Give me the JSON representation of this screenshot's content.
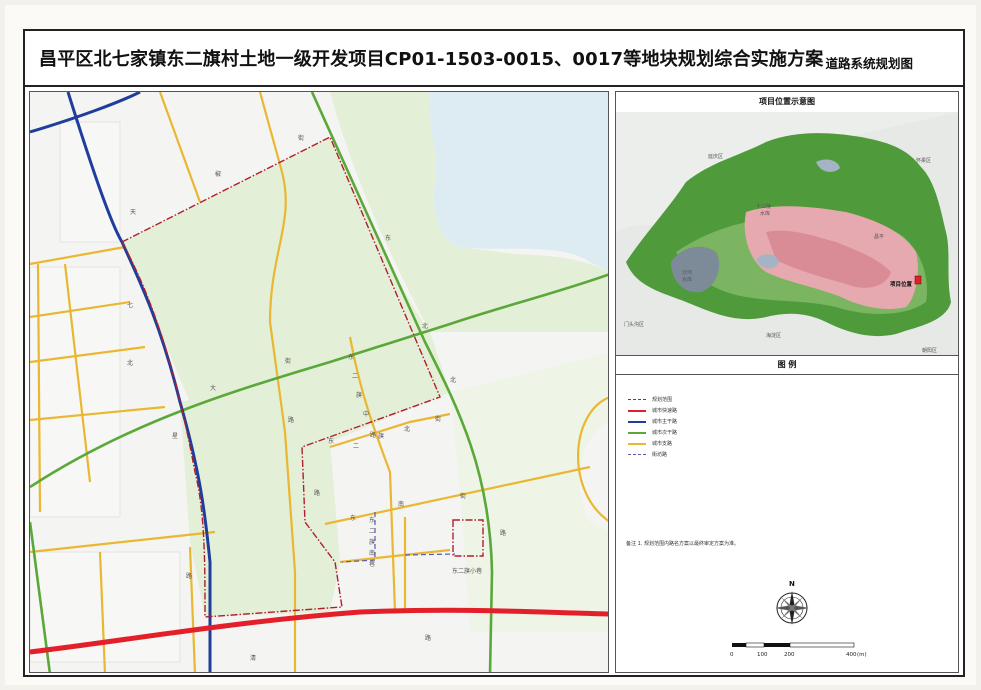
{
  "title": {
    "main": "昌平区北七家镇东二旗村土地一级开发项目CP01-1503-0015、0017等地块规划综合实施方案",
    "sub": "道路系统规划图"
  },
  "colors": {
    "expressway": "#e3202a",
    "arterial": "#1f3e9c",
    "secondary": "#5aa83a",
    "branch": "#e9b731",
    "street": "#5a5ab0",
    "boundary": "#b01e2d",
    "greenland": "#e4efd7",
    "water": "#dcecf2"
  },
  "map": {
    "street_labels": [
      {
        "text": "街"
      },
      {
        "text": "椒"
      },
      {
        "text": "天"
      },
      {
        "text": "东"
      },
      {
        "text": "北"
      },
      {
        "text": "七"
      },
      {
        "text": "大"
      },
      {
        "text": "街"
      },
      {
        "text": "东"
      },
      {
        "text": "二"
      },
      {
        "text": "旗"
      },
      {
        "text": "中"
      },
      {
        "text": "路"
      },
      {
        "text": "北"
      },
      {
        "text": "路"
      },
      {
        "text": "东"
      },
      {
        "text": "二"
      },
      {
        "text": "旗"
      },
      {
        "text": "北"
      },
      {
        "text": "街"
      },
      {
        "text": "星"
      },
      {
        "text": "路"
      },
      {
        "text": "东"
      },
      {
        "text": "南"
      },
      {
        "text": "街"
      },
      {
        "text": "路"
      },
      {
        "text": "东"
      },
      {
        "text": "二"
      },
      {
        "text": "旗"
      },
      {
        "text": "南"
      },
      {
        "text": "巷"
      },
      {
        "text": "东二旗小巷"
      },
      {
        "text": "路"
      },
      {
        "text": "北"
      },
      {
        "text": "清"
      },
      {
        "text": "路"
      }
    ]
  },
  "location_map": {
    "title": "项目位置示意图",
    "place_labels": [
      {
        "text": "延庆区"
      },
      {
        "text": "怀柔区"
      },
      {
        "text": "十三陵"
      },
      {
        "text": "水库"
      },
      {
        "text": "昌平"
      },
      {
        "text": "沙河"
      },
      {
        "text": "水库"
      },
      {
        "text": "门头沟区"
      },
      {
        "text": "海淀区"
      },
      {
        "text": "朝阳区"
      }
    ],
    "project_label": "项目位置"
  },
  "legend": {
    "title": "图    例",
    "items": [
      {
        "label": "规划范围",
        "kind": "boundary"
      },
      {
        "label": "城市快速路",
        "kind": "expressway"
      },
      {
        "label": "城市主干路",
        "kind": "arterial"
      },
      {
        "label": "城市次干路",
        "kind": "secondary"
      },
      {
        "label": "城市支路",
        "kind": "branch"
      },
      {
        "label": "街坊路",
        "kind": "street"
      }
    ],
    "note": "备注    1. 规划范围内路名方案以最终审定方案为准。"
  },
  "compass": {
    "north_label": "N"
  },
  "scale_bar": {
    "ticks": [
      "0",
      "100",
      "200",
      "400"
    ],
    "unit": "(m)"
  }
}
